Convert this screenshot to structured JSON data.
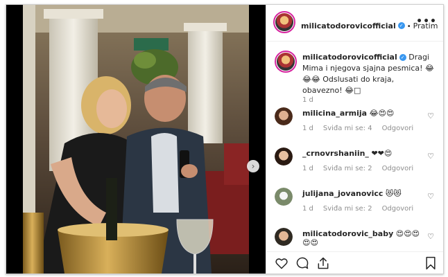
{
  "header": {
    "username": "milicatodorovicofficial",
    "separator": "•",
    "follow_label": "Pratim",
    "more_label": "•••"
  },
  "caption": {
    "username": "milicatodorovicofficial",
    "text": "Dragi Mima i njegova sjajna pesmica! 😂😂😂 Odslusati do kraja, obavezno! 😂□",
    "time": "1 d"
  },
  "comments": [
    {
      "username": "milicina_armija",
      "text": "😂😍😍",
      "time": "1 d",
      "likes": "Sviđa mi se: 4",
      "reply": "Odgovori"
    },
    {
      "username": "_crnovrshaniin_",
      "text": "❤❤😍",
      "time": "1 d",
      "likes": "Sviđa mi se: 2",
      "reply": "Odgovori"
    },
    {
      "username": "julijana_jovanovicc",
      "text": "😻😻",
      "time": "1 d",
      "likes": "Sviđa mi se: 2",
      "reply": "Odgovori"
    },
    {
      "username": "milicatodorovic_baby",
      "text": "😍😍😍😍😍",
      "time": "",
      "likes": "",
      "reply": ""
    }
  ],
  "media": {
    "next_label": "›"
  },
  "colors": {
    "accent": "#3897f0",
    "story_ring": "#d6249f",
    "muted": "#8e8e8e"
  },
  "icons": [
    "heart-icon",
    "comment-icon",
    "share-icon",
    "bookmark-icon",
    "verified-icon",
    "chevron-right-icon",
    "more-icon"
  ]
}
